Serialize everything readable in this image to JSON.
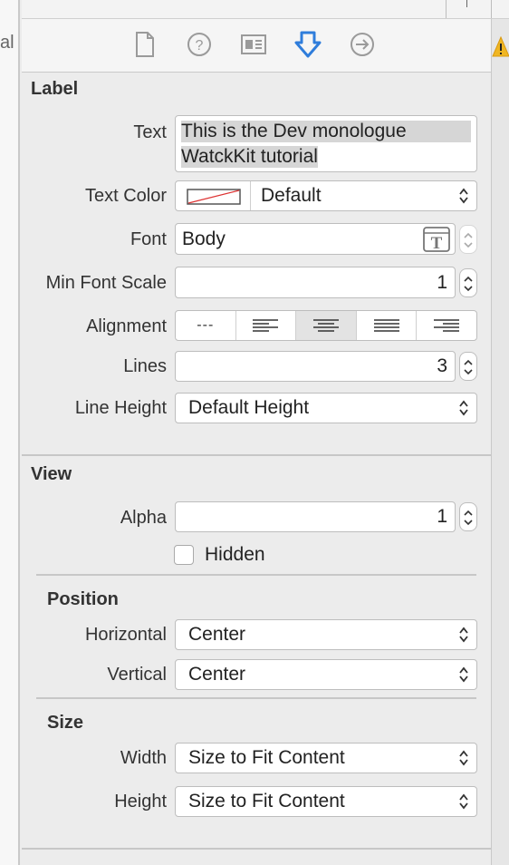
{
  "left_strip": {
    "fragment": "al"
  },
  "tabs": [
    {
      "name": "file-inspector",
      "icon": "file-icon"
    },
    {
      "name": "quick-help",
      "icon": "help-icon"
    },
    {
      "name": "identity-inspector",
      "icon": "identity-icon"
    },
    {
      "name": "attributes-inspector",
      "icon": "attributes-icon",
      "active": true
    },
    {
      "name": "connections-inspector",
      "icon": "connections-icon"
    }
  ],
  "accent_color": "#2f7ddb",
  "warning_icon": "warning-icon",
  "label_section": {
    "title": "Label",
    "text_label": "Text",
    "text_line1": "This is the Dev monologue",
    "text_line2": "WatckKit tutorial",
    "text_color_label": "Text Color",
    "text_color_value": "Default",
    "font_label": "Font",
    "font_value": "Body",
    "min_font_scale_label": "Min Font Scale",
    "min_font_scale_value": "1",
    "alignment_label": "Alignment",
    "alignment_options": [
      "---",
      "left",
      "center",
      "justified",
      "right"
    ],
    "alignment_selected": "center",
    "lines_label": "Lines",
    "lines_value": "3",
    "line_height_label": "Line Height",
    "line_height_value": "Default Height"
  },
  "view_section": {
    "title": "View",
    "alpha_label": "Alpha",
    "alpha_value": "1",
    "hidden_label": "Hidden",
    "hidden_checked": false,
    "position_title": "Position",
    "horizontal_label": "Horizontal",
    "horizontal_value": "Center",
    "vertical_label": "Vertical",
    "vertical_value": "Center",
    "size_title": "Size",
    "width_label": "Width",
    "width_value": "Size to Fit Content",
    "height_label": "Height",
    "height_value": "Size to Fit Content"
  }
}
